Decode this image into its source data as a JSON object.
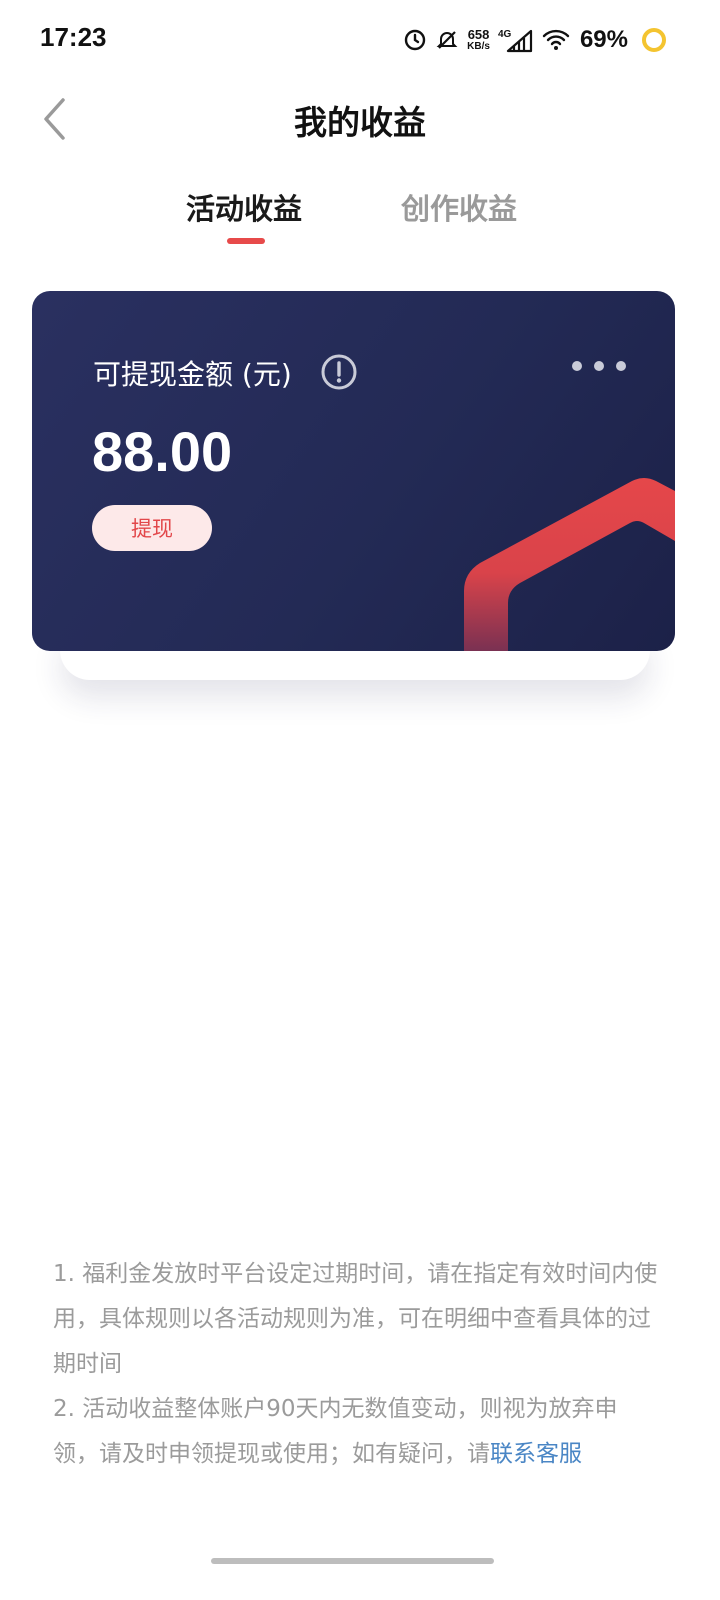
{
  "status_bar": {
    "time": "17:23",
    "net_speed_value": "658",
    "net_speed_unit": "KB/s",
    "network_type": "4G",
    "battery": "69%",
    "icons": [
      "alarm-icon",
      "notifications-off-icon",
      "signal-icon",
      "wifi-icon",
      "battery-icon"
    ]
  },
  "header": {
    "title": "我的收益",
    "back_icon": "chevron-left-icon"
  },
  "tabs": [
    {
      "label": "活动收益",
      "active": true
    },
    {
      "label": "创作收益",
      "active": false
    }
  ],
  "card": {
    "label": "可提现金额 (元)",
    "amount": "88.00",
    "withdraw_label": "提现",
    "info_icon": "info-icon",
    "more_icon": "more-icon"
  },
  "notes": {
    "line1": "1. 福利金发放时平台设定过期时间，请在指定有效时间内使用，具体规则以各活动规则为准，可在明细中查看具体的过期时间",
    "line2_text": "2. 活动收益整体账户90天内无数值变动，则视为放弃申领，请及时申领提现或使用；如有疑问，请",
    "line2_link": "联系客服"
  },
  "colors": {
    "accent_red": "#e74a4a",
    "card_bg": "#262d5a",
    "link_blue": "#4a86c5",
    "battery_ring": "#f4c430"
  }
}
